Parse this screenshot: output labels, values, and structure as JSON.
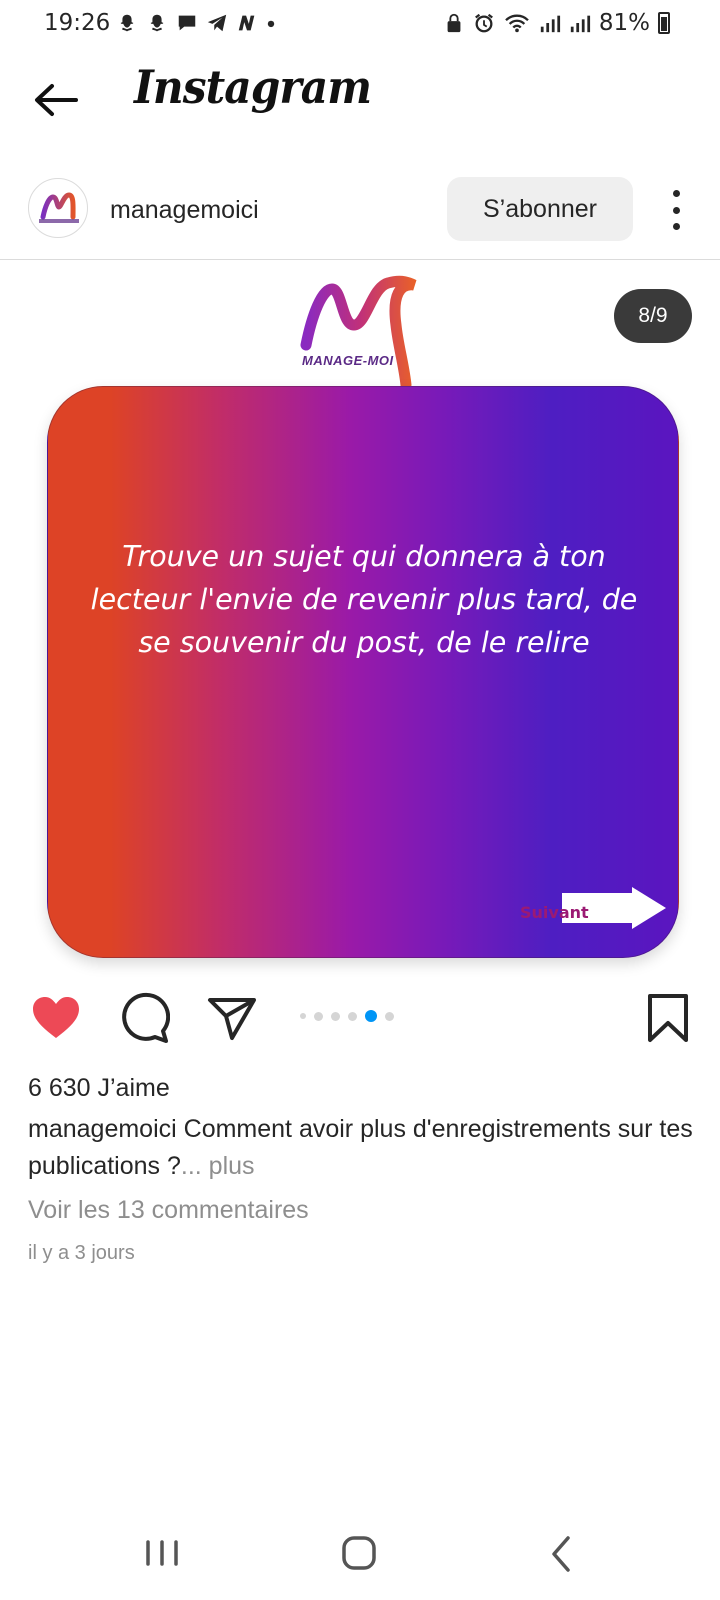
{
  "status_bar": {
    "time": "19:26",
    "battery": "81%",
    "left_icons": [
      "snapchat-icon",
      "snapchat-icon",
      "message-icon",
      "telegram-icon",
      "n-app-icon",
      "dot-icon"
    ],
    "right_icons": [
      "lock-icon",
      "alarm-icon",
      "wifi-icon",
      "signal-icon",
      "signal-icon",
      "battery-icon"
    ]
  },
  "header": {
    "title": "Instagram",
    "back_icon": "arrow-left-icon"
  },
  "post": {
    "username": "managemoici",
    "follow_label": "S’abonner",
    "slide_counter": "8/9",
    "slide": {
      "logo_text": "MANAGE-MOI",
      "text": "Trouve un sujet qui donnera à ton lecteur l'envie de revenir plus tard, de se souvenir du post, de le relire",
      "next_label": "Suivant",
      "gradient_colors": [
        "#dd4326",
        "#c02c6a",
        "#9a1aa8",
        "#4e1ec2",
        "#5b15c0"
      ]
    },
    "carousel": {
      "total_visible_dots": 5,
      "active_index": 4
    },
    "likes": "6 630 J’aime",
    "caption_user": "managemoici",
    "caption_text": "Comment avoir plus d'enregistrements sur tes publications ?",
    "caption_more": "... plus",
    "comments_link": "Voir les 13 commentaires",
    "timestamp": "il y a 3 jours"
  },
  "colors": {
    "like": "#ed4956",
    "active_dot": "#0095f6",
    "text": "#262626",
    "muted": "#8e8e8e"
  },
  "nav": {
    "recents": "recents-icon",
    "home": "home-icon",
    "back": "back-icon"
  }
}
